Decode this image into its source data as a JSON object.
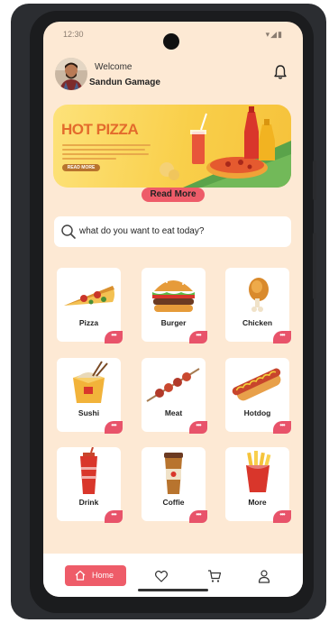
{
  "status": {
    "time": "12:30",
    "icons": "▾◢▮"
  },
  "header": {
    "welcome": "Welcome",
    "user_name": "Sandun Gamage"
  },
  "banner": {
    "title": "HOT PIZZA",
    "button_label": "READ MORE"
  },
  "read_more_label": "Read More",
  "search": {
    "placeholder": "what do you want to eat today?"
  },
  "categories": [
    {
      "label": "Pizza",
      "icon": "pizza-icon"
    },
    {
      "label": "Burger",
      "icon": "burger-icon"
    },
    {
      "label": "Chicken",
      "icon": "chicken-icon"
    },
    {
      "label": "Sushi",
      "icon": "sushi-box-icon"
    },
    {
      "label": "Meat",
      "icon": "skewer-icon"
    },
    {
      "label": "Hotdog",
      "icon": "hotdog-icon"
    },
    {
      "label": "Drink",
      "icon": "drink-icon"
    },
    {
      "label": "Coffie",
      "icon": "coffee-cup-icon"
    },
    {
      "label": "More",
      "icon": "fries-icon"
    }
  ],
  "card_action": "•••",
  "nav": {
    "home_label": "Home"
  },
  "colors": {
    "accent": "#ee5c69",
    "background": "#fde9d4",
    "banner": "#f9cf4a"
  }
}
